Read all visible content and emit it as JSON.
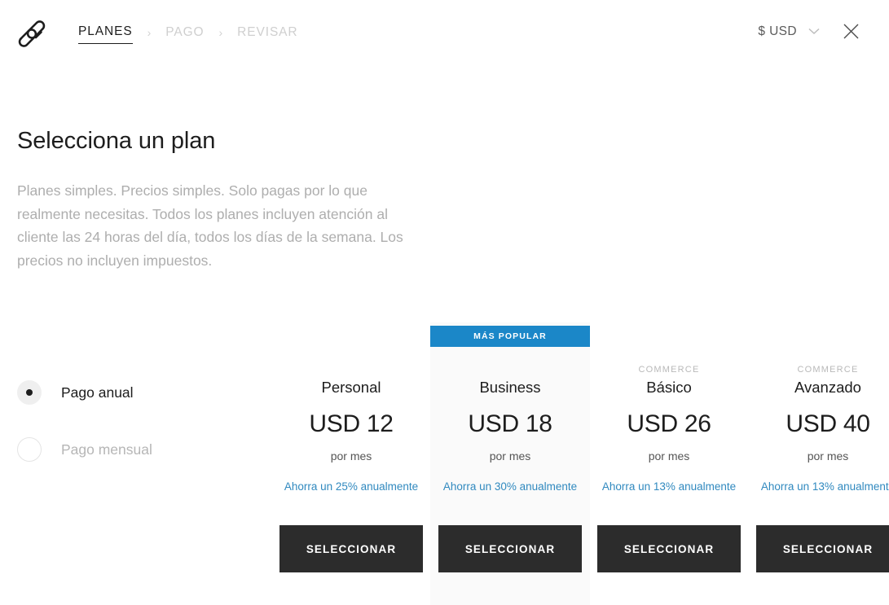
{
  "header": {
    "logo_name": "squarespace-logo",
    "breadcrumb": [
      {
        "label": "PLANES",
        "state": "active"
      },
      {
        "label": "PAGO",
        "state": "inactive"
      },
      {
        "label": "REVISAR",
        "state": "inactive"
      }
    ],
    "separator": "›",
    "currency": {
      "label": "$ USD"
    },
    "close_label": "✕"
  },
  "intro": {
    "title": "Selecciona un plan",
    "description": "Planes simples. Precios simples. Solo pagas por lo que realmente necesitas. Todos los planes incluyen atención al cliente las 24 horas del día, todos los días de la semana. Los precios no incluyen impuestos."
  },
  "billing": {
    "options": [
      {
        "label": "Pago anual",
        "selected": true
      },
      {
        "label": "Pago mensual",
        "selected": false
      }
    ]
  },
  "plans": {
    "popular_badge": "MÁS POPULAR",
    "cta_label": "SELECCIONAR",
    "items": [
      {
        "eyebrow": "",
        "name": "Personal",
        "price": "USD 12",
        "period": "por mes",
        "save": "Ahorra un 25% anualmente",
        "popular": false
      },
      {
        "eyebrow": "",
        "name": "Business",
        "price": "USD 18",
        "period": "por mes",
        "save": "Ahorra un 30% anualmente",
        "popular": true
      },
      {
        "eyebrow": "COMMERCE",
        "name": "Básico",
        "price": "USD 26",
        "period": "por mes",
        "save": "Ahorra un 13% anualmente",
        "popular": false
      },
      {
        "eyebrow": "COMMERCE",
        "name": "Avanzado",
        "price": "USD 40",
        "period": "por mes",
        "save": "Ahorra un 13% anualmente",
        "popular": false
      }
    ]
  },
  "colors": {
    "accent_blue": "#1b87c8",
    "link_blue": "#3089bf",
    "cta_dark": "#2c2c2c",
    "muted_text": "#aeaeae"
  }
}
